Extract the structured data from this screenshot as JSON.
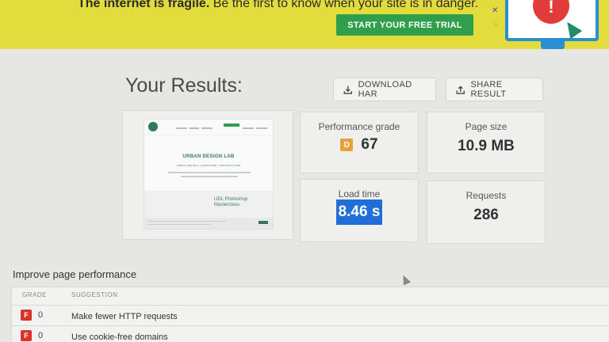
{
  "banner": {
    "headline_bold": "The internet is fragile.",
    "headline_rest": " Be the first to know when your site is in danger.",
    "cta_label": "START YOUR FREE TRIAL",
    "alert_glyph": "!",
    "alert_icon": "alert-monitor-icon"
  },
  "results": {
    "title": "Your Results:",
    "download_label": "DOWNLOAD HAR",
    "share_label": "SHARE RESULT"
  },
  "thumbnail": {
    "site_name": "URBAN DESIGN LAB",
    "site_tagline": "URBAN DESIGN | LANDSCAPE | ARCHITECTURE",
    "course_title": "UDL Photoshop Masterclass"
  },
  "metrics": {
    "performance_label": "Performance grade",
    "performance_grade": "D",
    "performance_score": "67",
    "page_size_label": "Page size",
    "page_size_value": "10.9 MB",
    "load_time_label": "Load time",
    "load_time_value": "8.46 s",
    "requests_label": "Requests",
    "requests_value": "286"
  },
  "improve": {
    "title": "Improve page performance",
    "columns": [
      "GRADE",
      "SUGGESTION"
    ],
    "rows": [
      {
        "grade": "F",
        "score": "0",
        "suggestion": "Make fewer HTTP requests"
      },
      {
        "grade": "F",
        "score": "0",
        "suggestion": "Use cookie-free domains"
      }
    ]
  },
  "colors": {
    "banner_bg": "#e2dc3c",
    "cta_green": "#2f9f4c",
    "grade_d": "#e8a03a",
    "grade_f": "#d9342b",
    "selection": "#1f6fd6"
  }
}
